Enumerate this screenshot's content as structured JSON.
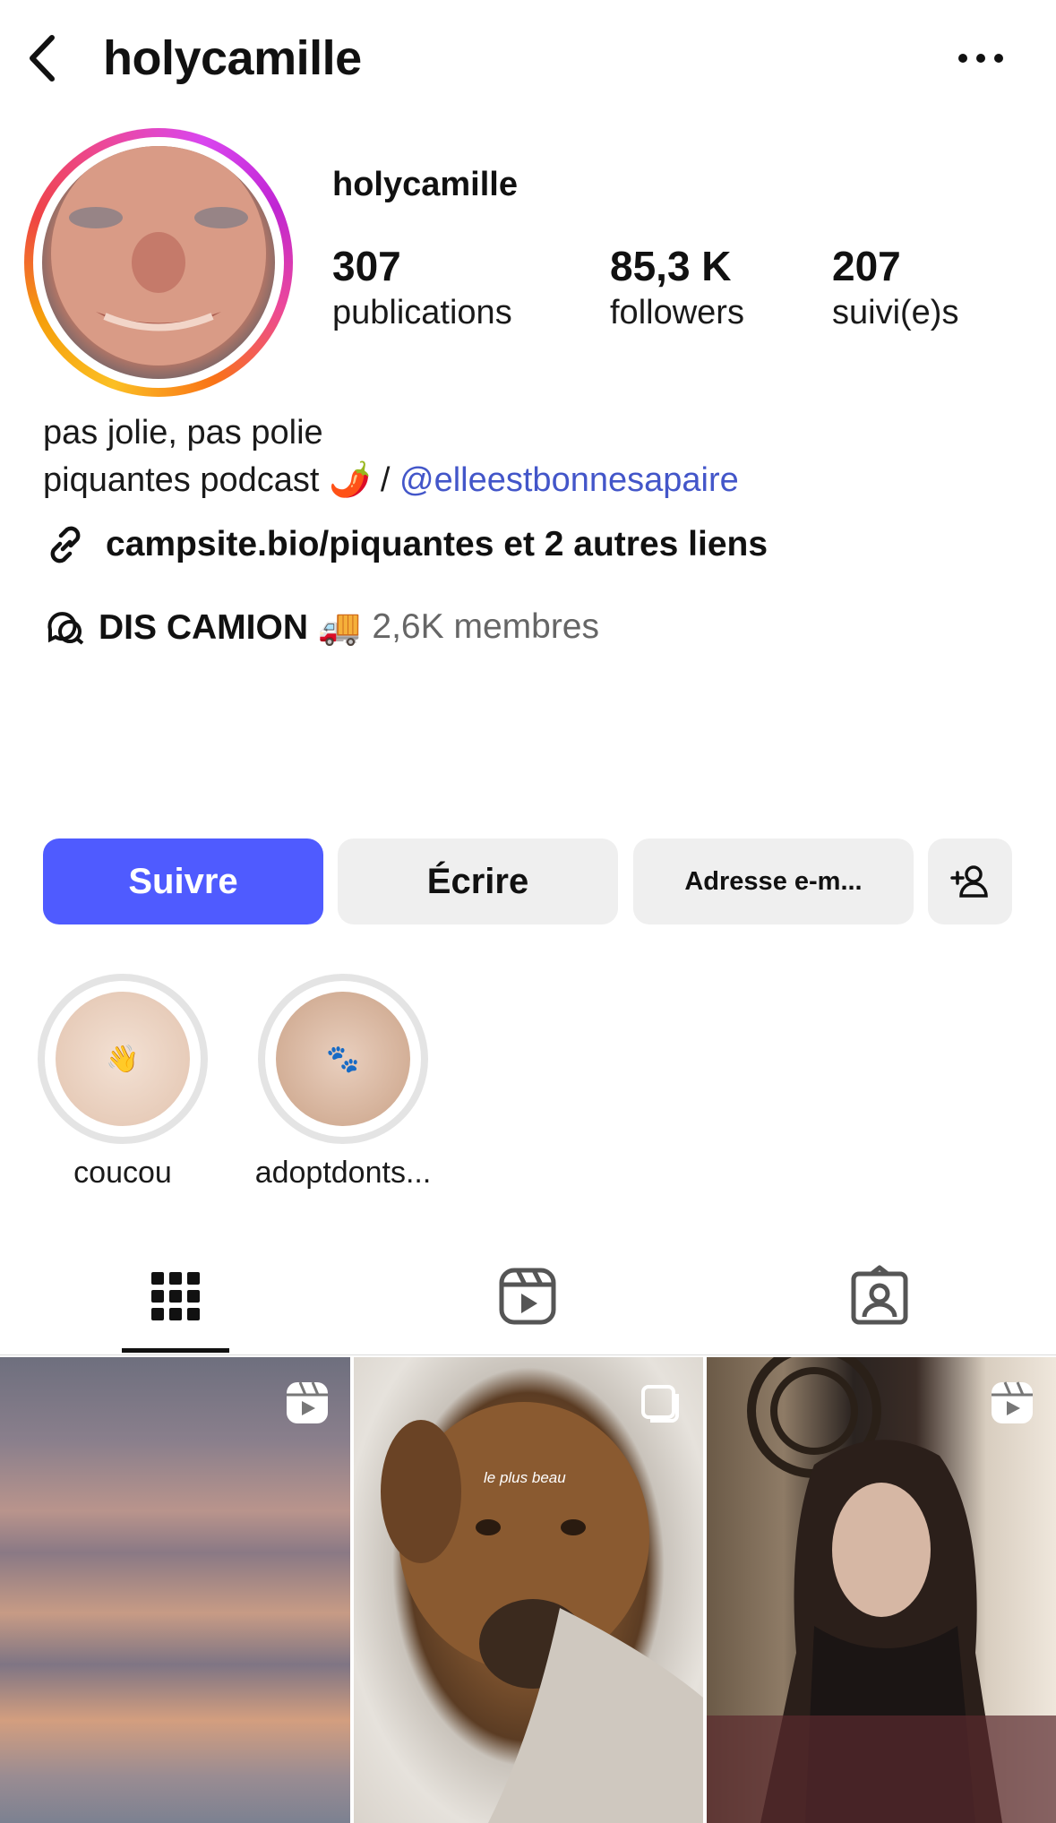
{
  "header": {
    "username": "holycamille",
    "back_icon": "chevron-left-icon",
    "more_icon": "more-horizontal-icon"
  },
  "profile": {
    "name": "holycamille",
    "stats": [
      {
        "value": "307",
        "label": "publications"
      },
      {
        "value": "85,3 K",
        "label": "followers"
      },
      {
        "value": "207",
        "label": "suivi(e)s"
      }
    ]
  },
  "bio": {
    "line1": "pas jolie, pas polie",
    "line2_text": "piquantes podcast 🌶️ /",
    "line2_mention": "@elleestbonnesapaire",
    "link_text": "campsite.bio/piquantes et 2 autres liens",
    "channel_name": "DIS CAMION 🚚",
    "channel_count": "2,6K membres"
  },
  "buttons": {
    "follow": "Suivre",
    "message": "Écrire",
    "email": "Adresse e-m...",
    "add_person_icon": "add-person-icon"
  },
  "highlights": [
    {
      "label": "coucou",
      "emoji": "👋"
    },
    {
      "label": "adoptdonts...",
      "emoji": "🐾"
    }
  ],
  "tabs": [
    "grid-icon",
    "reels-icon",
    "tagged-icon"
  ],
  "grid": {
    "tile2_caption": "le plus beau"
  },
  "colors": {
    "accent": "#4f5bff",
    "mention": "#4356c9",
    "button_bg": "#efefef"
  }
}
